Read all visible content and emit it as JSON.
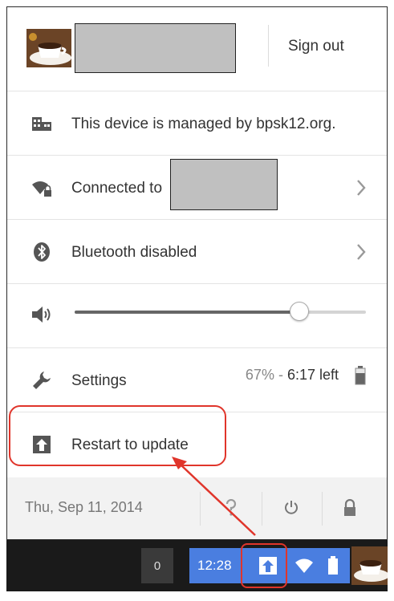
{
  "profile": {
    "signout_label": "Sign out"
  },
  "managed": {
    "label": "This device is managed by bpsk12.org."
  },
  "network": {
    "label": "Connected to"
  },
  "bluetooth": {
    "label": "Bluetooth disabled"
  },
  "volume": {
    "level": 0.77
  },
  "settings": {
    "label": "Settings",
    "battery_percent": "67%",
    "battery_separator": " - ",
    "battery_time": "6:17 left"
  },
  "update": {
    "label": "Restart to update"
  },
  "footer": {
    "date": "Thu, Sep 11, 2014"
  },
  "shelf": {
    "notification_count": "0",
    "clock": "12:28"
  },
  "colors": {
    "accent": "#4a7ee0",
    "annotation": "#e0352b",
    "shelf": "#1a1a1a"
  },
  "icons": {
    "managed": "building-icon",
    "network": "wifi-lock-icon",
    "bluetooth": "bluetooth-icon",
    "volume": "speaker-icon",
    "settings": "wrench-icon",
    "update": "update-arrow-icon",
    "help": "question-icon",
    "power": "power-icon",
    "lock": "lock-icon"
  }
}
